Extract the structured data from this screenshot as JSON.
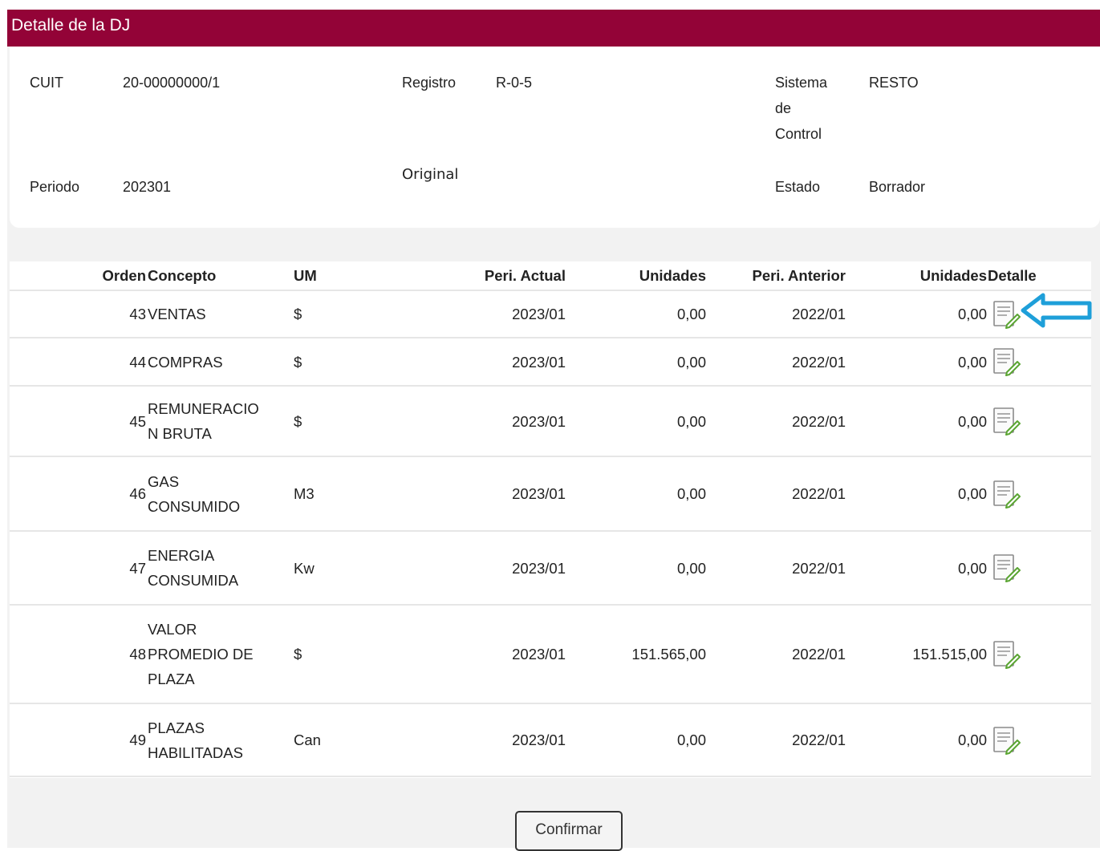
{
  "header": {
    "title": "Detalle de la DJ"
  },
  "info": {
    "cuit_label": "CUIT",
    "cuit_value": "20-00000000/1",
    "registro_label": "Registro",
    "registro_value": "R-0-5",
    "sistema_label_1": "Sistema",
    "sistema_label_2": "de",
    "sistema_label_3": "Control",
    "sistema_value": "RESTO",
    "periodo_label": "Periodo",
    "periodo_value": "202301",
    "tipo_value": "Original",
    "estado_label": "Estado",
    "estado_value": "Borrador"
  },
  "table": {
    "headers": {
      "orden": "Orden",
      "concepto": "Concepto",
      "um": "UM",
      "peri_actual": "Peri. Actual",
      "unidades": "Unidades",
      "peri_anterior": "Peri. Anterior",
      "unidades_ant": "Unidades",
      "detalle": "Detalle"
    },
    "rows": [
      {
        "orden": "43",
        "concepto_lines": [
          "VENTAS"
        ],
        "um": "$",
        "peri_actual": "2023/01",
        "unidades": "0,00",
        "peri_anterior": "2022/01",
        "unidades_ant": "0,00"
      },
      {
        "orden": "44",
        "concepto_lines": [
          "COMPRAS"
        ],
        "um": "$",
        "peri_actual": "2023/01",
        "unidades": "0,00",
        "peri_anterior": "2022/01",
        "unidades_ant": "0,00"
      },
      {
        "orden": "45",
        "concepto_lines": [
          "REMUNERACIO",
          "N BRUTA"
        ],
        "um": "$",
        "peri_actual": "2023/01",
        "unidades": "0,00",
        "peri_anterior": "2022/01",
        "unidades_ant": "0,00"
      },
      {
        "orden": "46",
        "concepto_lines": [
          "GAS",
          "CONSUMIDO"
        ],
        "um": "M3",
        "peri_actual": "2023/01",
        "unidades": "0,00",
        "peri_anterior": "2022/01",
        "unidades_ant": "0,00"
      },
      {
        "orden": "47",
        "concepto_lines": [
          "ENERGIA",
          "CONSUMIDA"
        ],
        "um": "Kw",
        "peri_actual": "2023/01",
        "unidades": "0,00",
        "peri_anterior": "2022/01",
        "unidades_ant": "0,00"
      },
      {
        "orden": "48",
        "concepto_lines": [
          "VALOR",
          "PROMEDIO DE",
          "PLAZA"
        ],
        "um": "$",
        "peri_actual": "2023/01",
        "unidades": "151.565,00",
        "peri_anterior": "2022/01",
        "unidades_ant": "151.515,00"
      },
      {
        "orden": "49",
        "concepto_lines": [
          "PLAZAS",
          "HABILITADAS"
        ],
        "um": "Can",
        "peri_actual": "2023/01",
        "unidades": "0,00",
        "peri_anterior": "2022/01",
        "unidades_ant": "0,00"
      }
    ]
  },
  "actions": {
    "confirm_label": "Confirmar"
  },
  "icons": {
    "detail": "edit-document-icon",
    "pointer": "arrow-left-icon"
  },
  "colors": {
    "header_bg": "#930337",
    "arrow": "#1e9fd9",
    "icon_pencil": "#5aa532"
  }
}
